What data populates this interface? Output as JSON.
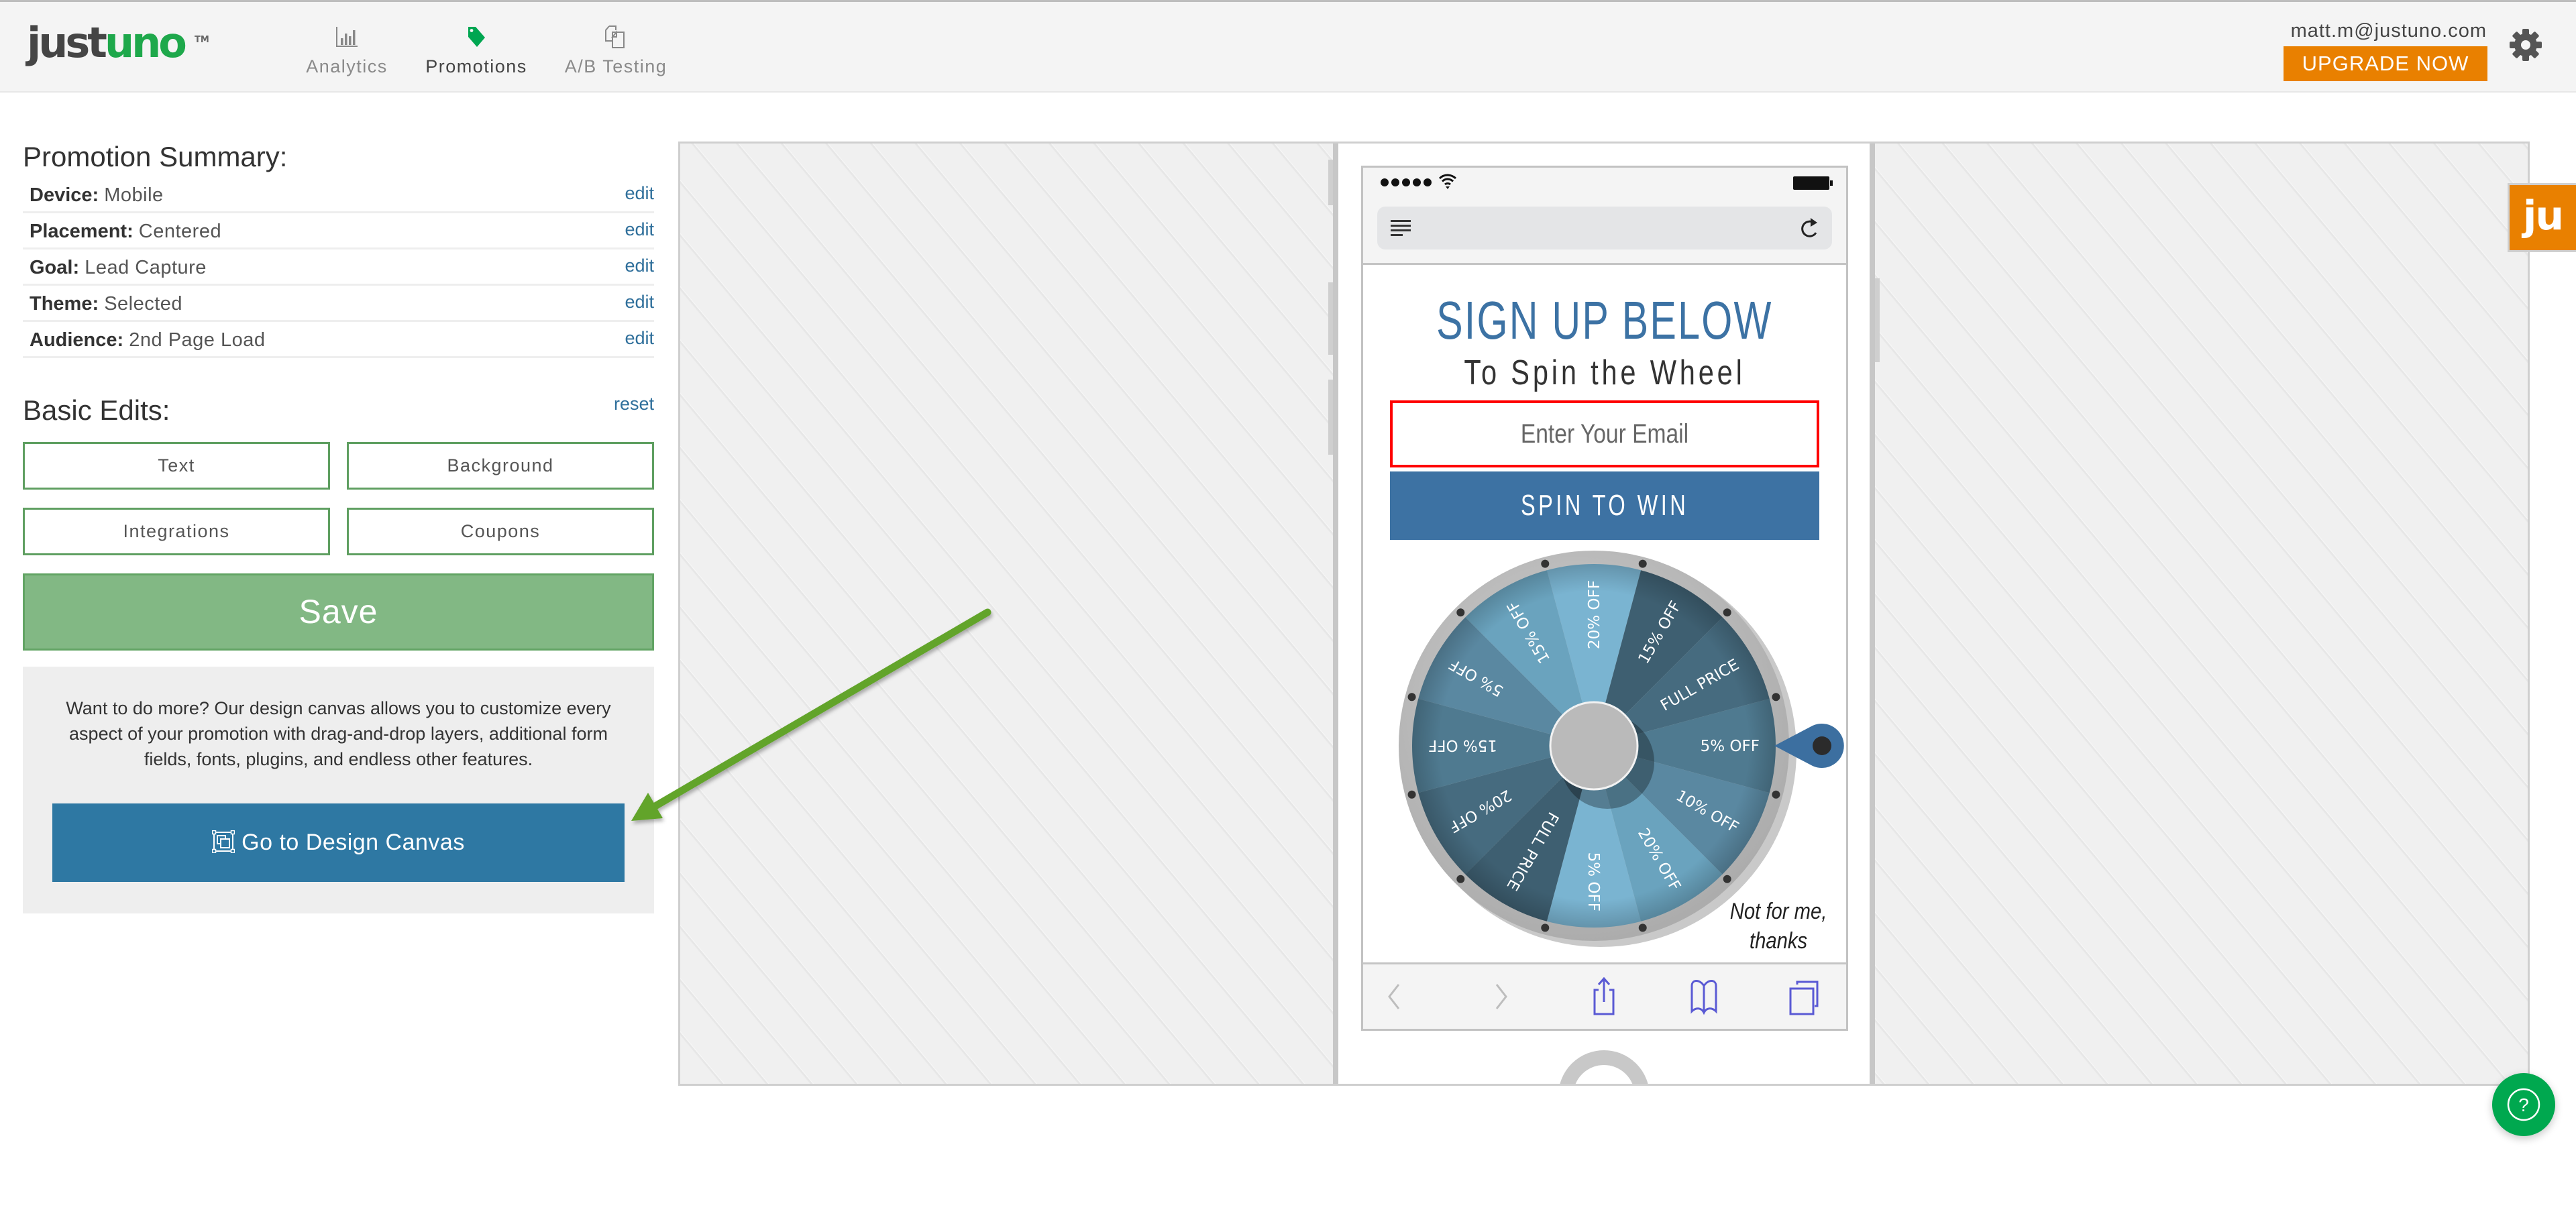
{
  "header": {
    "logo": {
      "dark": "just",
      "green": "uno",
      "tm": "TM"
    },
    "nav": [
      {
        "label": "Analytics",
        "icon": "bar-chart-icon",
        "active": false
      },
      {
        "label": "Promotions",
        "icon": "tag-icon",
        "active": true
      },
      {
        "label": "A/B Testing",
        "icon": "documents-icon",
        "active": false
      }
    ],
    "user_email": "matt.m@justuno.com",
    "upgrade_label": "UPGRADE NOW",
    "settings_icon": "gear-icon"
  },
  "summary": {
    "title": "Promotion Summary:",
    "rows": [
      {
        "label": "Device:",
        "value": "Mobile",
        "action": "edit"
      },
      {
        "label": "Placement:",
        "value": "Centered",
        "action": "edit"
      },
      {
        "label": "Goal:",
        "value": "Lead Capture",
        "action": "edit"
      },
      {
        "label": "Theme:",
        "value": "Selected",
        "action": "edit"
      },
      {
        "label": "Audience:",
        "value": "2nd Page Load",
        "action": "edit"
      }
    ]
  },
  "basic_edits": {
    "title": "Basic Edits:",
    "reset_label": "reset",
    "buttons": [
      "Text",
      "Background",
      "Integrations",
      "Coupons"
    ],
    "save_label": "Save"
  },
  "design_canvas_promo": {
    "description_lines": [
      "Want to do more? Our design canvas allows you to customize every",
      "aspect of your promotion with drag-and-drop layers, additional form",
      "fields, fonts, plugins, and endless other features."
    ],
    "button_label": "Go to Design Canvas",
    "button_icon": "design-canvas-icon"
  },
  "preview": {
    "device": "Mobile",
    "status_bar": {
      "signal_icon": "signal-dots-icon",
      "wifi_icon": "wifi-icon",
      "battery_icon": "battery-icon"
    },
    "address_bar": {
      "reader_icon": "reader-icon",
      "reload_icon": "reload-icon"
    },
    "headline": "SIGN UP BELOW",
    "subheadline": "To Spin the Wheel",
    "email_placeholder": "Enter Your Email",
    "cta_label": "SPIN TO WIN",
    "decline_lines": [
      "Not for me,",
      "thanks"
    ],
    "wheel": {
      "segments": [
        {
          "label": "20% OFF",
          "color": "#7ab4d1"
        },
        {
          "label": "15% OFF",
          "color": "#3e5f71"
        },
        {
          "label": "FULL PRICE",
          "color": "#466b7f"
        },
        {
          "label": "5% OFF",
          "color": "#4f7a90"
        },
        {
          "label": "10% OFF",
          "color": "#5a88a1"
        },
        {
          "label": "20% OFF",
          "color": "#6aa3be"
        },
        {
          "label": "5% OFF",
          "color": "#7ab4d1"
        },
        {
          "label": "FULL PRICE",
          "color": "#3e5f71"
        },
        {
          "label": "20% OFF",
          "color": "#466b7f"
        },
        {
          "label": "15% OFF",
          "color": "#4f7a90"
        },
        {
          "label": "5% OFF",
          "color": "#5a88a1"
        },
        {
          "label": "15% OFF",
          "color": "#6aa3be"
        }
      ],
      "hub_color": "#bababa",
      "rim_color": "#c3c3c3",
      "pointer_color": "#3c6fa0"
    },
    "toolbar": [
      "back-icon",
      "forward-icon",
      "share-icon",
      "bookmarks-icon",
      "tabs-icon"
    ]
  },
  "side_tab": {
    "label": "ju"
  },
  "help_button": {
    "icon": "help-icon",
    "glyph": "?"
  },
  "annotation": {
    "type": "arrow",
    "target": "Go to Design Canvas",
    "color": "#62a42c"
  },
  "colors": {
    "brand_green": "#1ea84b",
    "upgrade_orange": "#e98000",
    "design_button_blue": "#2e78a3",
    "save_green": "#82b884",
    "headline_blue": "#3c72a4",
    "input_error_red": "#ff0000"
  }
}
